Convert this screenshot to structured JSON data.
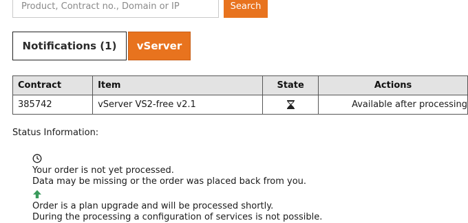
{
  "search": {
    "placeholder": "Product, Contract no., Domain or IP",
    "button_label": "Search"
  },
  "tabs": [
    {
      "label": "Notifications (1)",
      "active": false
    },
    {
      "label": "vServer",
      "active": true
    }
  ],
  "table": {
    "headers": [
      "Contract",
      "Item",
      "State",
      "Actions"
    ],
    "rows": [
      {
        "contract": "385742",
        "item": "vServer VS2-free v2.1",
        "state_icon": "hourglass-icon",
        "actions": "Available after processing"
      }
    ]
  },
  "status": {
    "title": "Status Information:",
    "items": [
      {
        "icon": "clock-icon",
        "line1": "Your order is not yet processed.",
        "line2": "Data may be missing or the order was placed back from you."
      },
      {
        "icon": "arrow-up-icon",
        "line1": "Order is a plan upgrade and will be processed shortly.",
        "line2": "During the processing a configuration of services is not possible."
      }
    ]
  },
  "colors": {
    "accent": "#e8731e",
    "upgrade_arrow": "#3a9a5b",
    "table_header_bg": "#e3e3e3"
  }
}
